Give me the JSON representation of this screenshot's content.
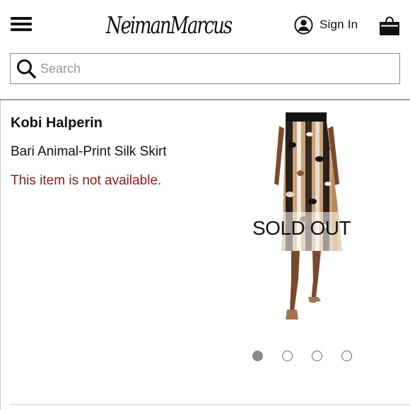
{
  "header": {
    "menu_icon": "hamburger-menu-icon",
    "logo_text": "NeimanMarcus",
    "signin_icon": "user-circle-icon",
    "signin_label": "Sign In",
    "bag_icon": "shopping-bag-icon"
  },
  "search": {
    "icon": "search-icon",
    "placeholder": "Search",
    "value": ""
  },
  "product": {
    "designer": "Kobi Halperin",
    "name": "Bari Animal-Print Silk Skirt",
    "availability": "This item is not available.",
    "image_overlay": "SOLD OUT",
    "carousel": {
      "total": 4,
      "active": 1
    }
  },
  "colors": {
    "availability_red": "#8b1a1a",
    "text": "#111111",
    "border": "#8c8c8c"
  }
}
